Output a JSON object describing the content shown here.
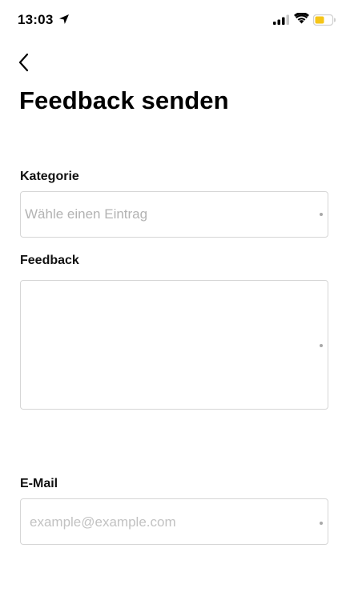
{
  "status_bar": {
    "time": "13:03",
    "icons": [
      "location-arrow-icon",
      "cellular-signal-icon",
      "wifi-icon",
      "battery-icon"
    ],
    "battery_color": "#f5c518"
  },
  "nav": {
    "back_icon": "chevron-left-icon"
  },
  "page": {
    "title": "Feedback senden"
  },
  "form": {
    "category": {
      "label": "Kategorie",
      "placeholder": "Wähle einen Eintrag"
    },
    "feedback": {
      "label": "Feedback",
      "value": ""
    },
    "email": {
      "label": "E-Mail",
      "placeholder": "example@example.com"
    }
  }
}
